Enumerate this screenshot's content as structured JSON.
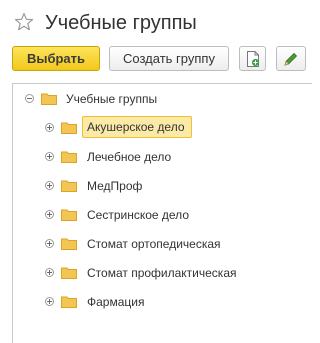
{
  "header": {
    "title": "Учебные группы",
    "favorite_icon": "star-icon"
  },
  "toolbar": {
    "select_label": "Выбрать",
    "create_group_label": "Создать группу",
    "new_item_icon": "add-document-icon",
    "edit_icon": "edit-icon"
  },
  "tree": {
    "root": {
      "label": "Учебные группы",
      "expanded": true
    },
    "items": [
      {
        "label": "Акушерское дело",
        "selected": true
      },
      {
        "label": "Лечебное дело",
        "selected": false
      },
      {
        "label": "МедПроф",
        "selected": false
      },
      {
        "label": "Сестринское дело",
        "selected": false
      },
      {
        "label": "Стомат ортопедическая",
        "selected": false
      },
      {
        "label": "Стомат профилактическая",
        "selected": false
      },
      {
        "label": "Фармация",
        "selected": false
      }
    ]
  },
  "colors": {
    "primary_button": "#f6d130",
    "folder": "#f3c552",
    "selection": "#fbe9a8"
  }
}
